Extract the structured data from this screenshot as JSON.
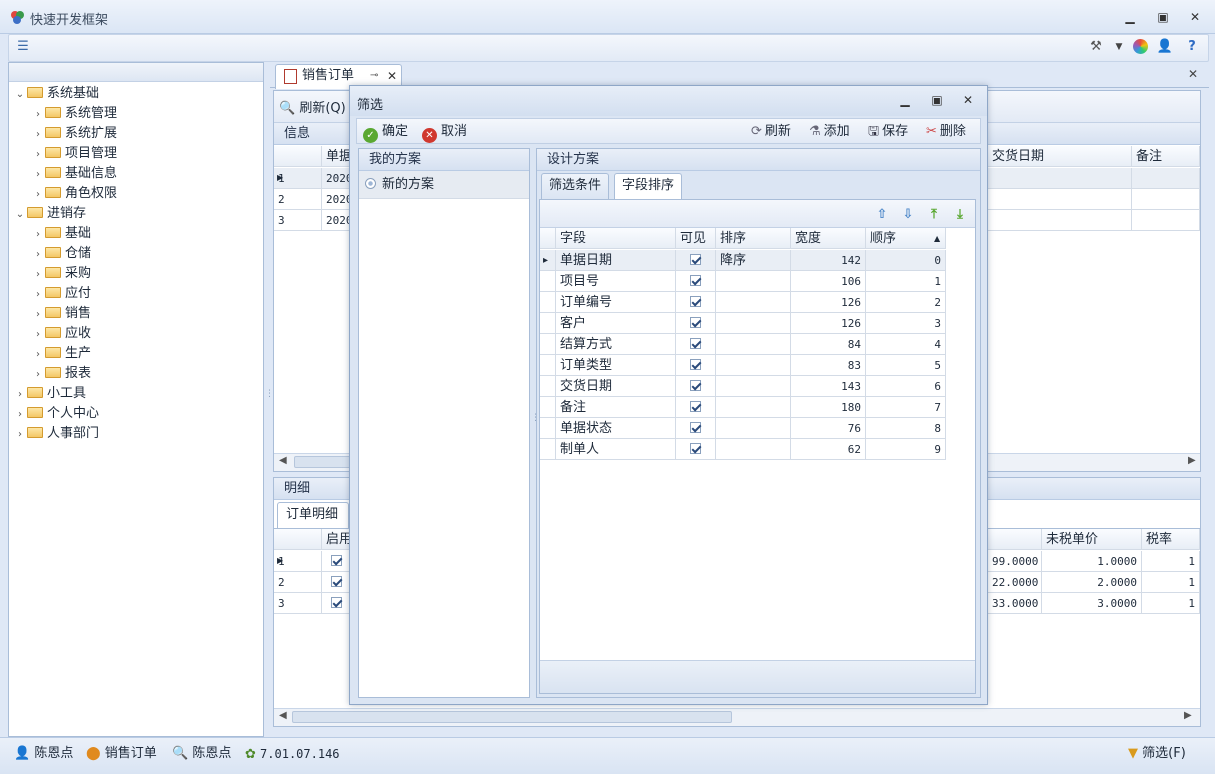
{
  "app": {
    "title": "快速开发框架"
  },
  "sidebar": {
    "items": [
      {
        "label": "系统基础",
        "level": 0,
        "expanded": true
      },
      {
        "label": "系统管理",
        "level": 1,
        "expanded": false
      },
      {
        "label": "系统扩展",
        "level": 1,
        "expanded": false
      },
      {
        "label": "项目管理",
        "level": 1,
        "expanded": false
      },
      {
        "label": "基础信息",
        "level": 1,
        "expanded": false
      },
      {
        "label": "角色权限",
        "level": 1,
        "expanded": false
      },
      {
        "label": "进销存",
        "level": 0,
        "expanded": true
      },
      {
        "label": "基础",
        "level": 1,
        "expanded": false
      },
      {
        "label": "仓储",
        "level": 1,
        "expanded": false
      },
      {
        "label": "采购",
        "level": 1,
        "expanded": false
      },
      {
        "label": "应付",
        "level": 1,
        "expanded": false
      },
      {
        "label": "销售",
        "level": 1,
        "expanded": false
      },
      {
        "label": "应收",
        "level": 1,
        "expanded": false
      },
      {
        "label": "生产",
        "level": 1,
        "expanded": false
      },
      {
        "label": "报表",
        "level": 1,
        "expanded": false
      },
      {
        "label": "小工具",
        "level": 0,
        "expanded": false
      },
      {
        "label": "个人中心",
        "level": 0,
        "expanded": false
      },
      {
        "label": "人事部门",
        "level": 0,
        "expanded": false
      }
    ]
  },
  "main": {
    "tab_label": "销售订单",
    "refresh_label": "刷新(Q)",
    "info_group": "信息",
    "info_columns": {
      "col1": "单据",
      "delivery": "交货日期",
      "remark": "备注"
    },
    "info_rows": [
      {
        "idx": "1",
        "date": "2020"
      },
      {
        "idx": "2",
        "date": "2020"
      },
      {
        "idx": "3",
        "date": "2020"
      }
    ],
    "detail_group": "明细",
    "detail_tab": "订单明细",
    "detail_columns": {
      "enabled": "启用",
      "price": "未税单价",
      "tax": "税率"
    },
    "detail_rows": [
      {
        "idx": "1",
        "amount": "99.0000",
        "price": "1.0000",
        "tax": "1"
      },
      {
        "idx": "2",
        "amount": "22.0000",
        "price": "2.0000",
        "tax": "1"
      },
      {
        "idx": "3",
        "amount": "33.0000",
        "price": "3.0000",
        "tax": "1"
      }
    ]
  },
  "dialog": {
    "title": "筛选",
    "confirm": "确定",
    "cancel": "取消",
    "refresh": "刷新",
    "add": "添加",
    "save": "保存",
    "delete": "删除",
    "my_schemes": "我的方案",
    "new_scheme": "新的方案",
    "design_scheme": "设计方案",
    "tab_filter": "筛选条件",
    "tab_field_sort": "字段排序",
    "columns": {
      "field": "字段",
      "visible": "可见",
      "sort": "排序",
      "width": "宽度",
      "order": "顺序"
    },
    "fields": [
      {
        "field": "单据日期",
        "sort": "降序",
        "width": "142",
        "order": "0"
      },
      {
        "field": "项目号",
        "sort": "",
        "width": "106",
        "order": "1"
      },
      {
        "field": "订单编号",
        "sort": "",
        "width": "126",
        "order": "2"
      },
      {
        "field": "客户",
        "sort": "",
        "width": "126",
        "order": "3"
      },
      {
        "field": "结算方式",
        "sort": "",
        "width": "84",
        "order": "4"
      },
      {
        "field": "订单类型",
        "sort": "",
        "width": "83",
        "order": "5"
      },
      {
        "field": "交货日期",
        "sort": "",
        "width": "143",
        "order": "6"
      },
      {
        "field": "备注",
        "sort": "",
        "width": "180",
        "order": "7"
      },
      {
        "field": "单据状态",
        "sort": "",
        "width": "76",
        "order": "8"
      },
      {
        "field": "制单人",
        "sort": "",
        "width": "62",
        "order": "9"
      }
    ]
  },
  "status": {
    "user": "陈恩点",
    "module": "销售订单",
    "user2": "陈恩点",
    "version": "7.01.07.146",
    "filter": "筛选(F)"
  },
  "colors": {
    "accent": "#5b8ac9",
    "window_bg": "#dfe8f6"
  }
}
